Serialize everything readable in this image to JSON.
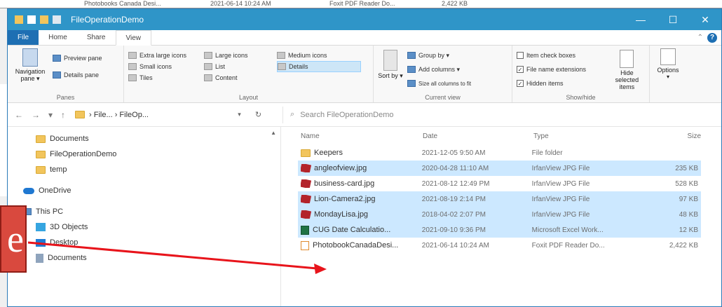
{
  "background": {
    "strip_name": "Photobooks Canada Desi...",
    "strip_date": "2021-06-14 10:24 AM",
    "strip_type": "Foxit PDF Reader Do...",
    "strip_size": "2,422 KB"
  },
  "window": {
    "title": "FileOperationDemo",
    "minimize": "—",
    "maximize": "☐",
    "close": "✕",
    "accent": "#2f95c8"
  },
  "ribbon_tabs": [
    "File",
    "Home",
    "Share",
    "View"
  ],
  "ribbon": {
    "panes": {
      "label": "Panes",
      "navigation_pane": "Navigation pane ▾",
      "preview_pane": "Preview pane",
      "details_pane": "Details pane"
    },
    "layout": {
      "label": "Layout",
      "items": [
        "Extra large icons",
        "Large icons",
        "Medium icons",
        "Small icons",
        "List",
        "Details",
        "Tiles",
        "Content"
      ]
    },
    "current_view": {
      "label": "Current view",
      "sort_by": "Sort by ▾",
      "group_by": "Group by ▾",
      "add_columns": "Add columns ▾",
      "size_all": "Size all columns to fit"
    },
    "show_hide": {
      "label": "Show/hide",
      "item_check_boxes": "Item check boxes",
      "file_name_extensions": "File name extensions",
      "hidden_items": "Hidden items",
      "hide_selected": "Hide selected items"
    },
    "options": "Options"
  },
  "address": {
    "back": "←",
    "forward": "→",
    "recent": "▾",
    "up": "↑",
    "path": "› File... › FileOp...",
    "dropdown": "▾",
    "refresh": "↻",
    "search_placeholder": "Search FileOperationDemo"
  },
  "nav_pane": {
    "items": [
      "Documents",
      "FileOperationDemo",
      "temp",
      "OneDrive",
      "This PC",
      "3D Objects",
      "Desktop",
      "Documents"
    ]
  },
  "files": {
    "headers": {
      "name": "Name",
      "date": "Date",
      "type": "Type",
      "size": "Size"
    },
    "rows": [
      {
        "name": "Keepers",
        "date": "2021-12-05 9:50 AM",
        "type": "File folder",
        "size": ""
      },
      {
        "name": "angleofview.jpg",
        "date": "2020-04-28 11:10 AM",
        "type": "IrfanView JPG File",
        "size": "235 KB"
      },
      {
        "name": "business-card.jpg",
        "date": "2021-08-12 12:49 PM",
        "type": "IrfanView JPG File",
        "size": "528 KB"
      },
      {
        "name": "Lion-Camera2.jpg",
        "date": "2021-08-19 2:14 PM",
        "type": "IrfanView JPG File",
        "size": "97 KB"
      },
      {
        "name": "MondayLisa.jpg",
        "date": "2018-04-02 2:07 PM",
        "type": "IrfanView JPG File",
        "size": "48 KB"
      },
      {
        "name": "CUG Date Calculatio...",
        "date": "2021-09-10 9:36 PM",
        "type": "Microsoft Excel Work...",
        "size": "12 KB"
      },
      {
        "name": "PhotobookCanadaDesi...",
        "date": "2021-06-14 10:24 AM",
        "type": "Foxit PDF Reader Do...",
        "size": "2,422 KB"
      }
    ]
  },
  "callout": {
    "text": "e",
    "color": "#d9493e"
  }
}
